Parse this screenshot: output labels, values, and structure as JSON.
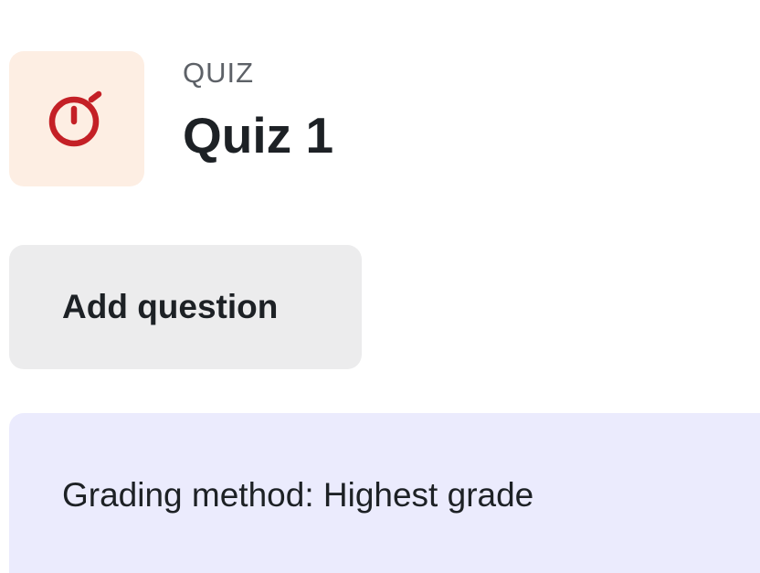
{
  "header": {
    "icon": "stopwatch-icon",
    "icon_color": "#c42026",
    "icon_bg": "#fdeee3",
    "module_type": "QUIZ",
    "title": "Quiz 1"
  },
  "actions": {
    "add_question_label": "Add question"
  },
  "grading": {
    "text": "Grading method: Highest grade"
  }
}
